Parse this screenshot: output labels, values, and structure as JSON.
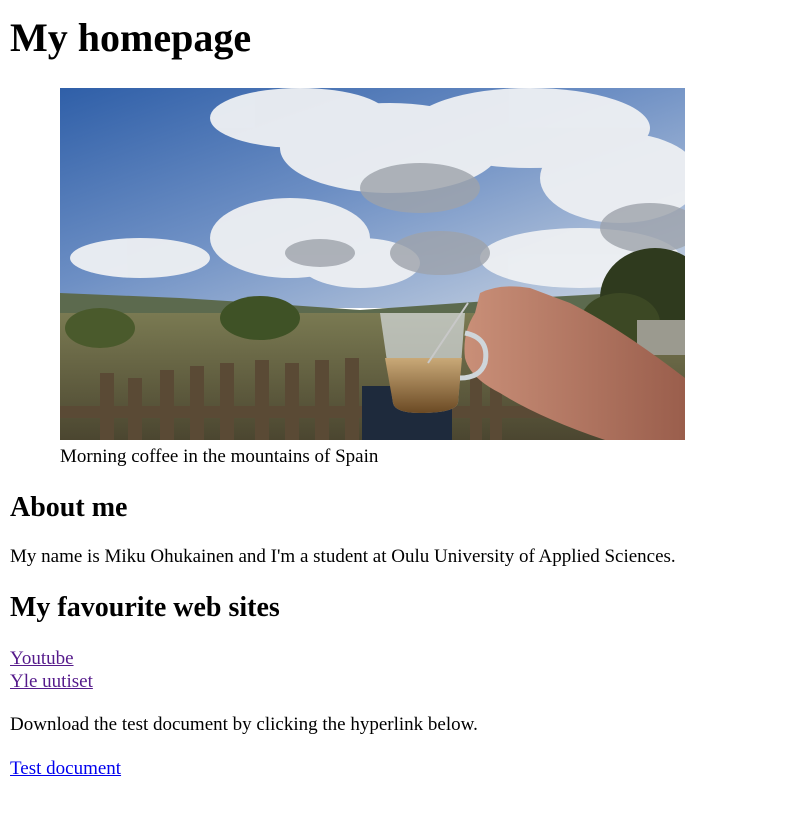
{
  "header": {
    "title": "My homepage"
  },
  "figure": {
    "image_icon": "photo-coffee-mountains",
    "caption": "Morning coffee in the mountains of Spain"
  },
  "about": {
    "heading": "About me",
    "text": "My name is Miku Ohukainen and I'm a student at Oulu University of Applied Sciences."
  },
  "sites": {
    "heading": "My favourite web sites",
    "links": [
      {
        "label": "Youtube"
      },
      {
        "label": "Yle uutiset"
      }
    ]
  },
  "download": {
    "text": "Download the test document by clicking the hyperlink below.",
    "link_label": "Test document"
  },
  "colors": {
    "visited_link": "#551a8b",
    "unvisited_link": "#0000ee"
  }
}
